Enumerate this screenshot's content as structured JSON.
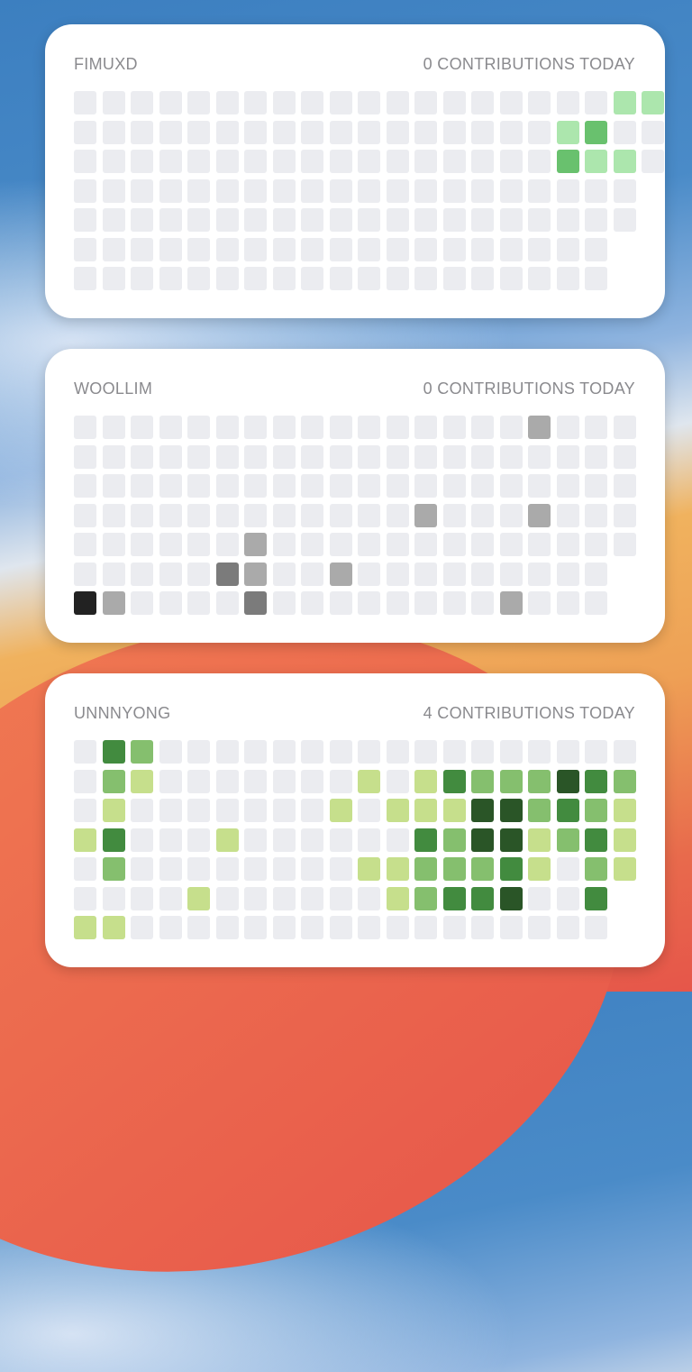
{
  "widgets": [
    {
      "user": "FIMUXD",
      "status": "0 CONTRIBUTIONS TODAY",
      "palette": [
        "#ebecf0",
        "#ace6ad",
        "#69c16e",
        "#3f9b47",
        "#2a6b30"
      ],
      "grid": [
        "000000000000000000011",
        "000000000000000001200",
        "000000000000000002110",
        "00000000000000000000",
        "00000000000000000000",
        "0000000000000000000-",
        "0000000000000000000-"
      ]
    },
    {
      "user": "WOOLLIM",
      "status": "0 CONTRIBUTIONS TODAY",
      "palette": [
        "#ebecf0",
        "#cfcfcf",
        "#aaaaaa",
        "#7b7b7b",
        "#222222"
      ],
      "grid": [
        "00000000000000002000",
        "00000000000000000000",
        "00000000000000000000",
        "00000000000020002000",
        "00000020000000000000",
        "0000032002000000000-",
        "4200003000000002000-"
      ]
    },
    {
      "user": "UNNNYONG",
      "status": "4 CONTRIBUTIONS TODAY",
      "palette": [
        "#ebecf0",
        "#c6df8c",
        "#85bf6e",
        "#428b3f",
        "#2a5527"
      ],
      "grid": [
        "03200000000000000000",
        "02100000001013222432",
        "01000000010111442321",
        "13000100000032441231",
        "02000000001122231021",
        "0000100000012334003-",
        "1100000000000000000-"
      ]
    }
  ]
}
